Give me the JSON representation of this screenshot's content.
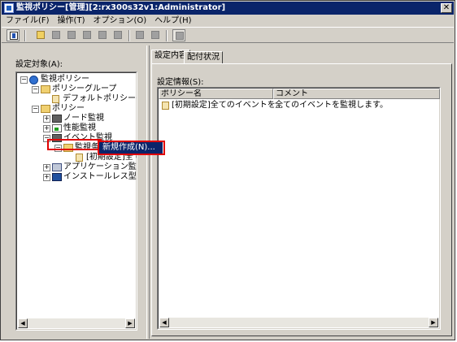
{
  "window": {
    "title": "監視ポリシー[管理][2:rx300s32v1:Administrator]",
    "close_glyph": "✕"
  },
  "menubar": {
    "items": [
      "ファイル(F)",
      "操作(T)",
      "オプション(O)",
      "ヘルプ(H)"
    ]
  },
  "toolbar": {
    "icons": [
      "properties-icon",
      "new-icon",
      "copy-icon",
      "edit-icon",
      "paste-icon",
      "duplicate-icon",
      "delete-icon",
      "import-icon",
      "export-icon",
      "refresh-icon"
    ]
  },
  "left": {
    "label": "設定対象(A):",
    "tree": {
      "root": "監視ポリシー",
      "policy_group": "ポリシーグループ",
      "default_policy_group": "デフォルトポリシーグル",
      "policy": "ポリシー",
      "node_monitoring": "ノード監視",
      "performance_monitoring": "性能監視",
      "event_monitoring": "イベント監視",
      "monitoring_condition": "監視条件",
      "initial_setting_child": "[初期設定]全て",
      "application_monitoring": "アプリケーション監視",
      "installless_monitoring": "インストールレス型エ"
    },
    "context_menu": {
      "new_item": "新規作成(N)..."
    }
  },
  "right": {
    "tabs": [
      "設定内容",
      "配付状況"
    ],
    "settings_label": "設定情報(S):",
    "columns": [
      "ポリシー名",
      "コメント"
    ],
    "rows": [
      {
        "name": "[初期設定]全てのイベントを...",
        "comment": "全てのイベントを監視します。"
      }
    ]
  },
  "colors": {
    "titlebar": "#0a246a",
    "highlight": "#e00000",
    "face": "#d4d0c8"
  }
}
